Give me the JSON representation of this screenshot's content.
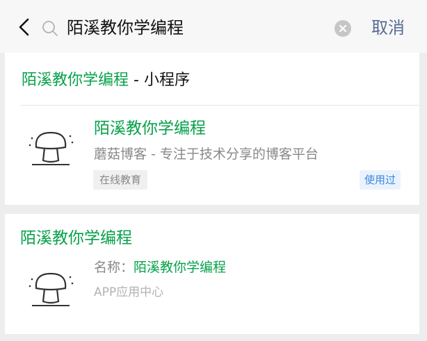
{
  "search": {
    "query": "陌溪教你学编程",
    "cancel_label": "取消"
  },
  "miniprogram": {
    "section_keyword": "陌溪教你学编程",
    "section_suffix": " - 小程序",
    "name": "陌溪教你学编程",
    "description": "蘑菇博客 - 专注于技术分享的博客平台",
    "tag": "在线教育",
    "badge": "使用过"
  },
  "app": {
    "section_title": "陌溪教你学编程",
    "name_label": "名称：",
    "name_value": "陌溪教你学编程",
    "category": "APP应用中心"
  },
  "colors": {
    "accent_green": "#07a14a",
    "link_blue": "#576b95",
    "badge_blue": "#3b86e0"
  },
  "icons": [
    "back-arrow-icon",
    "search-icon",
    "clear-icon",
    "mushroom-logo-icon"
  ]
}
